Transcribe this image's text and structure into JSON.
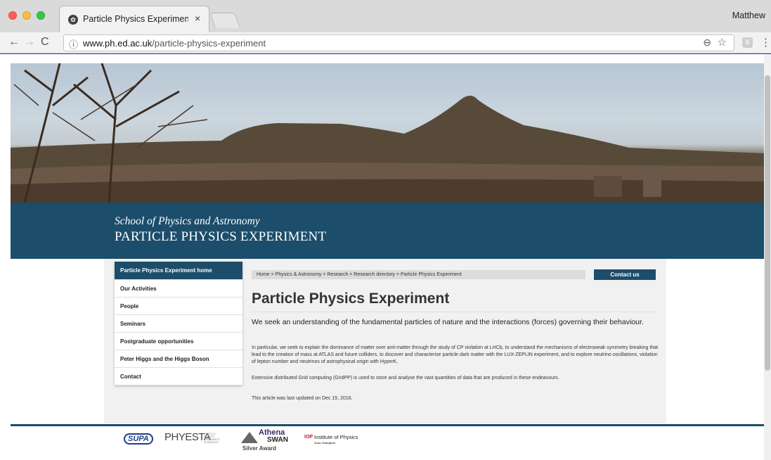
{
  "browser": {
    "tab_title": "Particle Physics Experiment | S",
    "tab_close": "×",
    "profile_name": "Matthew",
    "url_host": "www.ph.ed.ac.uk",
    "url_path": "/particle-physics-experiment",
    "icons": {
      "back": "←",
      "forward": "→",
      "reload": "C",
      "info": "ⓘ",
      "zoom": "⊖",
      "star": "☆",
      "menu": "⋮"
    }
  },
  "header": {
    "school": "School of Physics and Astronomy",
    "unit": "PARTICLE PHYSICS EXPERIMENT"
  },
  "sidebar": {
    "items": [
      {
        "label": "Particle Physics Experiment home"
      },
      {
        "label": "Our Activities"
      },
      {
        "label": "People"
      },
      {
        "label": "Seminars"
      },
      {
        "label": "Postgraduate opportunities"
      },
      {
        "label": "Peter Higgs and the Higgs Boson"
      },
      {
        "label": "Contact"
      }
    ]
  },
  "breadcrumb": "Home  >  Physics & Astronomy  >  Research  >  Research directory  >  Particle Physics Experiment",
  "contact_button": "Contact us",
  "main": {
    "title": "Particle Physics Experiment",
    "lead": "We seek an understanding of the fundamental particles of nature and the interactions (forces) governing their behaviour.",
    "paragraph1": "In particular, we seek to explain the dominance of matter over anti-matter through the study of CP violation at LHCb, to understand the mechanisms of electroweak symmetry breaking that lead to the creation of mass at ATLAS and future colliders, to discover and characterise particle dark matter with the LUX-ZEPLIN experiment, and to explore neutrino oscillations, violation of lepton number and neutrinos of astrophysical origin with HyperK.",
    "paragraph2": "Extensive distributed Grid computing (GridPP) is used to store and analyse the vast quantities of data that are produced in these endeavours.",
    "updated": "This article was last updated on Dec 15, 2016."
  },
  "footer": {
    "logos": {
      "supa": "SUPA",
      "phyesta": "PHYESTA",
      "phyesta_sub": "PARTICLE PHYSICS EXPERIMENT EDINBURGH",
      "athena": "Athena",
      "swan": "SWAN",
      "silver": "Silver Award",
      "iop": "IOP",
      "iop_name": "Institute of Physics",
      "iop_sub": "Juno Champion"
    }
  },
  "colors": {
    "brand_blue": "#1c4d6b",
    "desktop": "#3b3bd8"
  }
}
